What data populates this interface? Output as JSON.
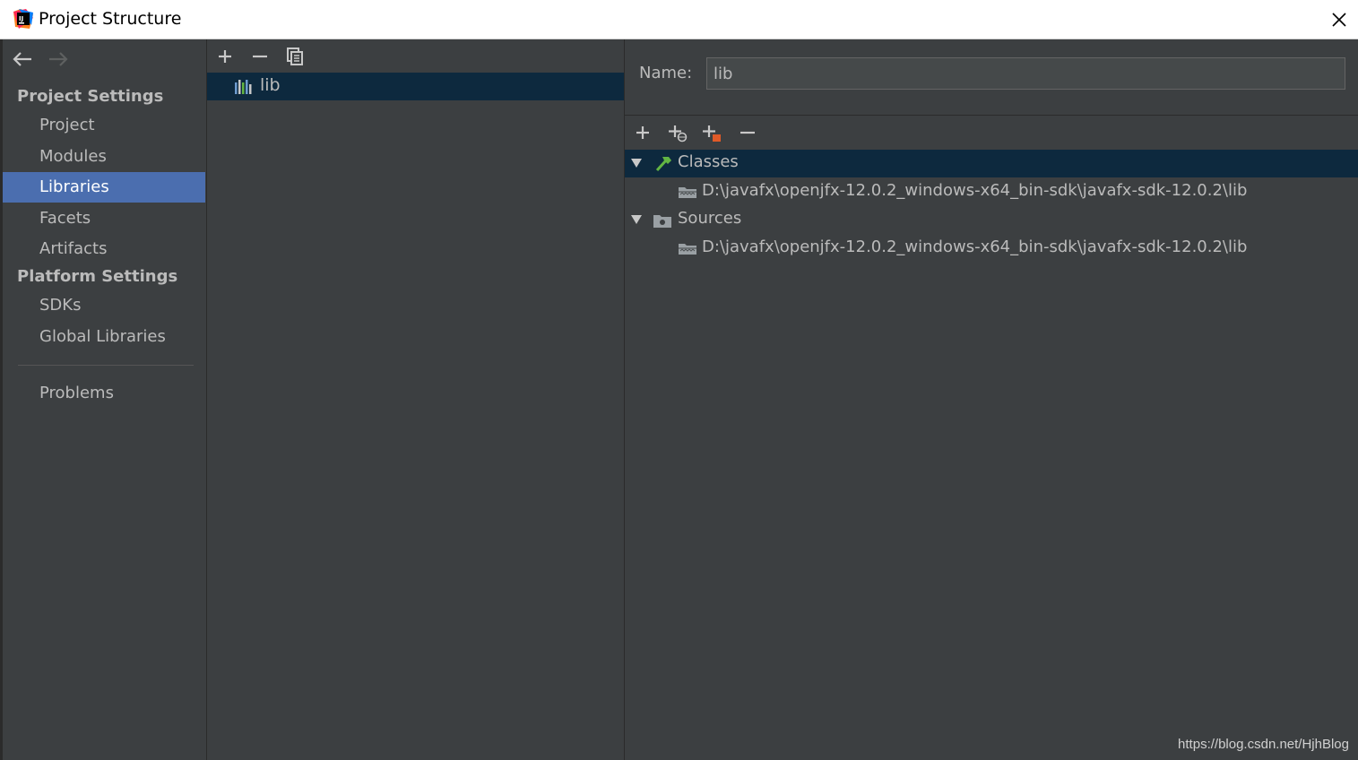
{
  "window": {
    "title": "Project Structure"
  },
  "sidebar": {
    "project_settings_header": "Project Settings",
    "platform_settings_header": "Platform Settings",
    "items": [
      {
        "label": "Project"
      },
      {
        "label": "Modules"
      },
      {
        "label": "Libraries",
        "selected": true
      },
      {
        "label": "Facets"
      },
      {
        "label": "Artifacts"
      },
      {
        "label": "SDKs"
      },
      {
        "label": "Global Libraries"
      },
      {
        "label": "Problems"
      }
    ]
  },
  "libraries": {
    "toolbar": [
      "add-icon",
      "remove-icon",
      "copy-icon"
    ],
    "list": [
      {
        "label": "lib",
        "selected": true
      }
    ]
  },
  "details": {
    "name_label": "Name:",
    "name_value": "lib",
    "toolbar": [
      "add-icon",
      "add-url-icon",
      "add-jar-icon",
      "remove-icon"
    ],
    "tree": {
      "classes": {
        "label": "Classes",
        "path": "D:\\javafx\\openjfx-12.0.2_windows-x64_bin-sdk\\javafx-sdk-12.0.2\\lib"
      },
      "sources": {
        "label": "Sources",
        "path": "D:\\javafx\\openjfx-12.0.2_windows-x64_bin-sdk\\javafx-sdk-12.0.2\\lib"
      }
    }
  },
  "watermark": "https://blog.csdn.net/HjhBlog",
  "colors": {
    "background": "#3c3f41",
    "selection_sidebar": "#4b6eaf",
    "selection_tree": "#0d293e",
    "text": "#bbbbbb"
  }
}
